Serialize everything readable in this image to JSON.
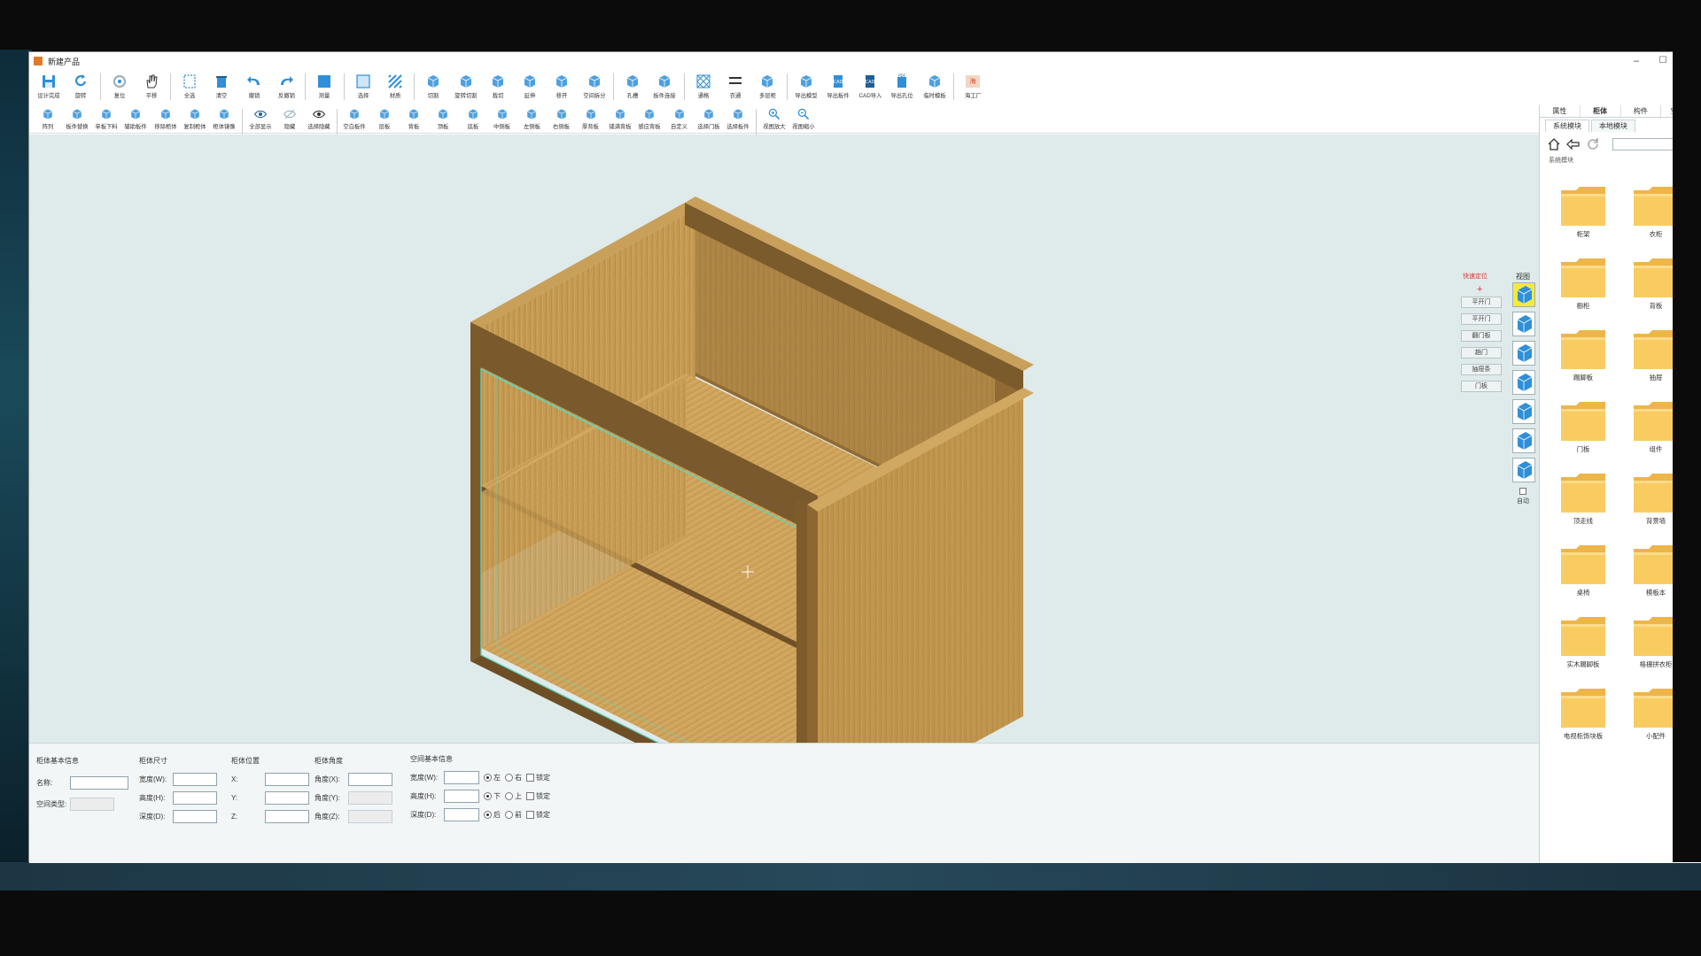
{
  "window": {
    "title": "新建产品",
    "controls": [
      "–",
      "☐",
      "✕"
    ]
  },
  "toolbar1": [
    {
      "label": "设计完成",
      "icon": "save-icon"
    },
    {
      "label": "旋转",
      "icon": "rotate-icon"
    },
    {
      "label": "复位",
      "icon": "reset-icon"
    },
    {
      "label": "平移",
      "icon": "hand-icon"
    },
    {
      "label": "全选",
      "icon": "select-all-icon"
    },
    {
      "label": "清空",
      "icon": "clear-icon"
    },
    {
      "label": "撤销",
      "icon": "undo-icon"
    },
    {
      "label": "反撤销",
      "icon": "redo-icon"
    },
    {
      "label": "测量",
      "icon": "measure-icon"
    },
    {
      "label": "选择",
      "icon": "select-box-icon"
    },
    {
      "label": "材质",
      "icon": "material-icon"
    },
    {
      "label": "切割",
      "icon": "cut-icon"
    },
    {
      "label": "旋转切割",
      "icon": "rotate-cut-icon"
    },
    {
      "label": "裁切",
      "icon": "trim-icon"
    },
    {
      "label": "延伸",
      "icon": "extend-icon"
    },
    {
      "label": "移开",
      "icon": "move-apart-icon"
    },
    {
      "label": "空间拆分",
      "icon": "space-split-icon"
    },
    {
      "label": "孔槽",
      "icon": "hole-slot-icon"
    },
    {
      "label": "板件连接",
      "icon": "board-link-icon"
    },
    {
      "label": "通格",
      "icon": "grid-icon"
    },
    {
      "label": "衣通",
      "icon": "rail-icon"
    },
    {
      "label": "多层柜",
      "icon": "multi-layer-icon"
    },
    {
      "label": "导出模型",
      "icon": "export-model-icon"
    },
    {
      "label": "导出板件",
      "icon": "cad-export-icon"
    },
    {
      "label": "CAD导入",
      "icon": "cad-import-icon"
    },
    {
      "label": "导出孔位",
      "icon": "pdf-export-icon"
    },
    {
      "label": "临时模板",
      "icon": "template-icon"
    },
    {
      "label": "海工厂",
      "icon": "factory-icon"
    }
  ],
  "toolbar2": [
    {
      "label": "阵列",
      "icon": "array-icon"
    },
    {
      "label": "板件替换",
      "icon": "replace-icon"
    },
    {
      "label": "单板下料",
      "icon": "single-board-icon"
    },
    {
      "label": "辅助板件",
      "icon": "aux-board-icon"
    },
    {
      "label": "移除柜体",
      "icon": "remove-cabinet-icon"
    },
    {
      "label": "复制柜体",
      "icon": "copy-cabinet-icon"
    },
    {
      "label": "柜体镜像",
      "icon": "mirror-icon"
    },
    {
      "label": "全部显示",
      "icon": "eye-icon"
    },
    {
      "label": "隐藏",
      "icon": "hide-icon"
    },
    {
      "label": "选择隐藏",
      "icon": "select-hide-icon"
    },
    {
      "label": "空白板件",
      "icon": "blank-board-icon"
    },
    {
      "label": "层板",
      "icon": "shelf-icon"
    },
    {
      "label": "背板",
      "icon": "back-board-icon"
    },
    {
      "label": "顶板",
      "icon": "top-board-icon"
    },
    {
      "label": "底板",
      "icon": "bottom-board-icon"
    },
    {
      "label": "中侧板",
      "icon": "mid-side-icon"
    },
    {
      "label": "左侧板",
      "icon": "left-side-icon"
    },
    {
      "label": "右侧板",
      "icon": "right-side-icon"
    },
    {
      "label": "厚背板",
      "icon": "thick-back-icon"
    },
    {
      "label": "铺满背板",
      "icon": "fill-back-icon"
    },
    {
      "label": "感应背板",
      "icon": "sense-back-icon"
    },
    {
      "label": "自定义",
      "icon": "custom-icon"
    },
    {
      "label": "选择门板",
      "icon": "select-door-icon"
    },
    {
      "label": "选择板件",
      "icon": "select-board-icon"
    },
    {
      "label": "视图放大",
      "icon": "zoom-in-icon"
    },
    {
      "label": "视图缩小",
      "icon": "zoom-out-icon"
    }
  ],
  "viewport": {
    "mini_title": "快速定位",
    "view_title": "视图",
    "mini_buttons": [
      "平开门",
      "平开门",
      "翻门板",
      "趟门",
      "抽屉条",
      "门板"
    ],
    "view_cube_label": "自动"
  },
  "bottom": {
    "basic": {
      "title": "柜体基本信息",
      "name_label": "名称:",
      "type_label": "空间类型:",
      "name_value": "",
      "type_value": ""
    },
    "size": {
      "title": "柜体尺寸",
      "rows": [
        {
          "label": "宽度(W):",
          "value": ""
        },
        {
          "label": "高度(H):",
          "value": ""
        },
        {
          "label": "深度(D):",
          "value": ""
        }
      ]
    },
    "position": {
      "title": "柜体位置",
      "rows": [
        {
          "label": "X:",
          "value": ""
        },
        {
          "label": "Y:",
          "value": ""
        },
        {
          "label": "Z:",
          "value": ""
        }
      ]
    },
    "angle": {
      "title": "柜体角度",
      "rows": [
        {
          "label": "角度(X):",
          "value": ""
        },
        {
          "label": "角度(Y):",
          "value": ""
        },
        {
          "label": "角度(Z):",
          "value": ""
        }
      ]
    },
    "space": {
      "title": "空间基本信息",
      "rows": [
        {
          "label": "宽度(W):",
          "value": "",
          "opt1": "左",
          "opt2": "右",
          "lock": "锁定"
        },
        {
          "label": "高度(H):",
          "value": "",
          "opt1": "下",
          "opt2": "上",
          "lock": "锁定"
        },
        {
          "label": "深度(D):",
          "value": "",
          "opt1": "后",
          "opt2": "前",
          "lock": "锁定"
        }
      ]
    }
  },
  "sidepanel": {
    "tabs": [
      "属性",
      "柜体",
      "构件",
      "空间树"
    ],
    "active_tab": "柜体",
    "subtabs": [
      "系统模块",
      "本地模块"
    ],
    "section_label": "系统模块",
    "search_value": "",
    "folders": [
      "柜架",
      "衣柜",
      "橱柜",
      "背板",
      "踢脚板",
      "抽屉",
      "门板",
      "组件",
      "顶走线",
      "背景墙",
      "桌椅",
      "模板本",
      "实木踢脚板",
      "格栅拼衣柜",
      "电视柜饰块板",
      "小配件"
    ]
  },
  "colors": {
    "viewport_bg": "#dfeaea",
    "wood_light": "#c9a25a",
    "wood_mid": "#b88d45",
    "wood_dark": "#8a6630",
    "accent_blue": "#2f8fd8",
    "folder_yellow": "#f6c55c"
  }
}
